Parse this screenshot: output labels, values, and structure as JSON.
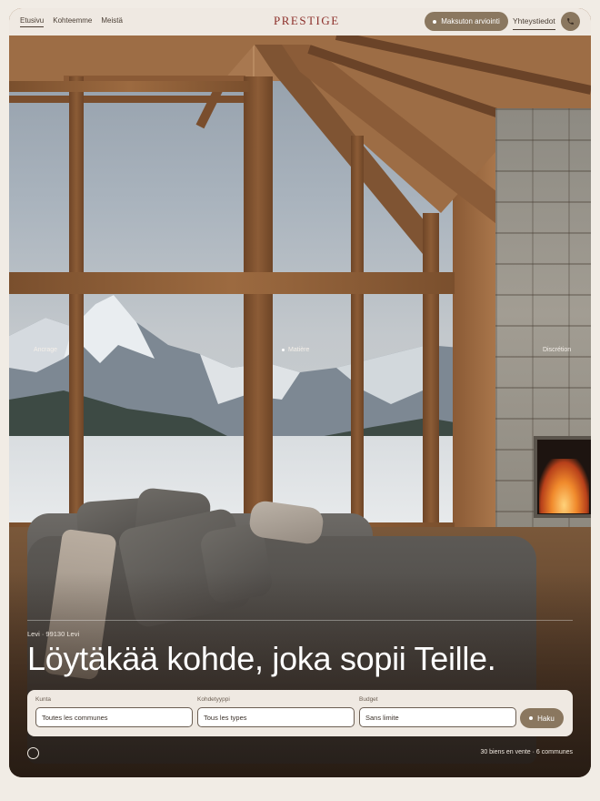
{
  "nav": {
    "links": [
      "Etusivu",
      "Kohteemme",
      "Meistä"
    ],
    "brand": "PRESTIGE",
    "cta_label": "Maksuton arviointi",
    "contact_label": "Yhteystiedot",
    "phone_icon": "phone-icon"
  },
  "hero": {
    "labels": [
      "Ancrage",
      "Matière",
      "Discrétion"
    ],
    "location": "Levi · 99130 Levi",
    "headline": "Löytäkää kohde, joka sopii Teille."
  },
  "search": {
    "fields": [
      {
        "label": "Kunta",
        "value": "Toutes les communes"
      },
      {
        "label": "Kohdetyyppi",
        "value": "Tous les types"
      },
      {
        "label": "Budget",
        "value": "Sans limite"
      }
    ],
    "button_label": "Haku"
  },
  "footer": {
    "stats": "30 biens en vente · 6 communes"
  },
  "colors": {
    "accent": "#8a775f",
    "brand": "#8c2f2a",
    "nav_bg": "#efe9e2"
  }
}
